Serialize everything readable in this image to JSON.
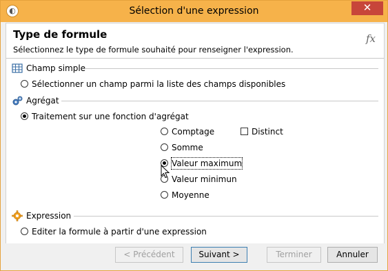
{
  "window": {
    "title": "Sélection d'une expression",
    "app_icon": "app-logo-icon",
    "close_label": "✕"
  },
  "header": {
    "title": "Type de formule",
    "subtitle": "Sélectionnez le type de formule souhaité pour renseigner l'expression.",
    "fx_label": "fx"
  },
  "sections": {
    "simple": {
      "label": "Champ simple",
      "icon": "grid-icon",
      "option": {
        "label": "Sélectionner un champ parmi la liste des champs disponibles",
        "selected": false
      }
    },
    "aggregate": {
      "label": "Agrégat",
      "icon": "gears-icon",
      "option": {
        "label": "Traitement sur une fonction d'agrégat",
        "selected": true
      },
      "functions": [
        {
          "label": "Comptage",
          "selected": false
        },
        {
          "label": "Somme",
          "selected": false
        },
        {
          "label": "Valeur maximum",
          "selected": true
        },
        {
          "label": "Valeur minimun",
          "selected": false
        },
        {
          "label": "Moyenne",
          "selected": false
        }
      ],
      "distinct": {
        "label": "Distinct",
        "checked": false
      }
    },
    "expression": {
      "label": "Expression",
      "icon": "gear-orange-icon",
      "option": {
        "label": "Editer la formule à partir d'une expression",
        "selected": false
      }
    }
  },
  "buttons": {
    "previous": "< Précédent",
    "next": "Suivant >",
    "finish": "Terminer",
    "cancel": "Annuler"
  },
  "colors": {
    "titlebar": "#f6b24a",
    "close": "#c7463a",
    "accent_border": "#3c7fb1"
  }
}
